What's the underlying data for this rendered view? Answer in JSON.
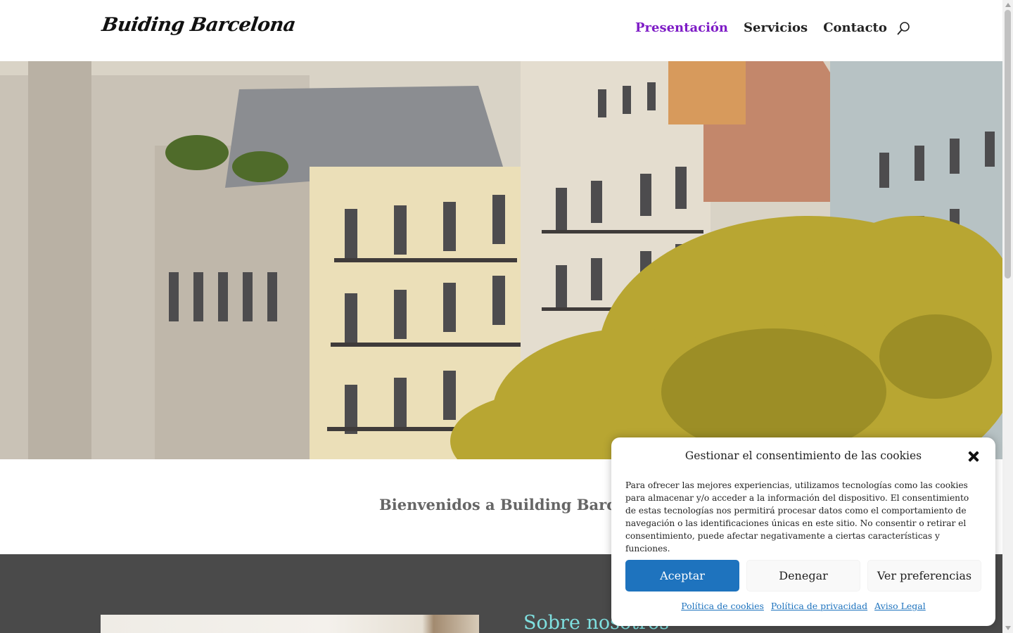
{
  "header": {
    "logo": "Buiding Barcelona",
    "nav": [
      {
        "label": "Presentación",
        "active": true
      },
      {
        "label": "Servicios",
        "active": false
      },
      {
        "label": "Contacto",
        "active": false
      }
    ],
    "search_icon": "search-icon",
    "accent_color": "#7e1cc6"
  },
  "welcome": {
    "title": "Bienvenidos a Building Barcelona"
  },
  "about": {
    "title": "Sobre nosotros"
  },
  "cookie_modal": {
    "title": "Gestionar el consentimiento de las cookies",
    "body": "Para ofrecer las mejores experiencias, utilizamos tecnologías como las cookies para almacenar y/o acceder a la información del dispositivo. El consentimiento de estas tecnologías nos permitirá procesar datos como el comportamiento de navegación o las identificaciones únicas en este sitio. No consentir o retirar el consentimiento, puede afectar negativamente a ciertas características y funciones.",
    "buttons": {
      "accept": "Aceptar",
      "deny": "Denegar",
      "preferences": "Ver preferencias"
    },
    "links": {
      "cookies": "Política de cookies",
      "privacy": "Política de privacidad",
      "legal": "Aviso Legal"
    },
    "close_icon": "close-icon",
    "button_color": "#1e73be"
  }
}
